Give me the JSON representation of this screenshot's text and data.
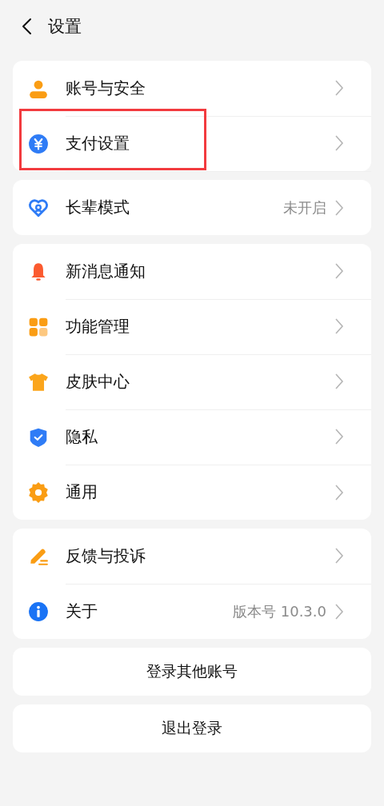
{
  "header": {
    "title": "设置"
  },
  "groups": [
    {
      "items": [
        {
          "label": "账号与安全",
          "highlighted": false
        },
        {
          "label": "支付设置",
          "highlighted": true
        }
      ]
    },
    {
      "items": [
        {
          "label": "长辈模式",
          "value": "未开启",
          "highlighted": false
        }
      ]
    },
    {
      "items": [
        {
          "label": "新消息通知",
          "highlighted": false
        },
        {
          "label": "功能管理",
          "highlighted": false
        },
        {
          "label": "皮肤中心",
          "highlighted": false
        },
        {
          "label": "隐私",
          "highlighted": false
        },
        {
          "label": "通用",
          "highlighted": false
        }
      ]
    },
    {
      "items": [
        {
          "label": "反馈与投诉",
          "highlighted": false
        },
        {
          "label": "关于",
          "value": "版本号 10.3.0",
          "highlighted": false
        }
      ]
    }
  ],
  "buttons": [
    "登录其他账号",
    "退出登录"
  ]
}
